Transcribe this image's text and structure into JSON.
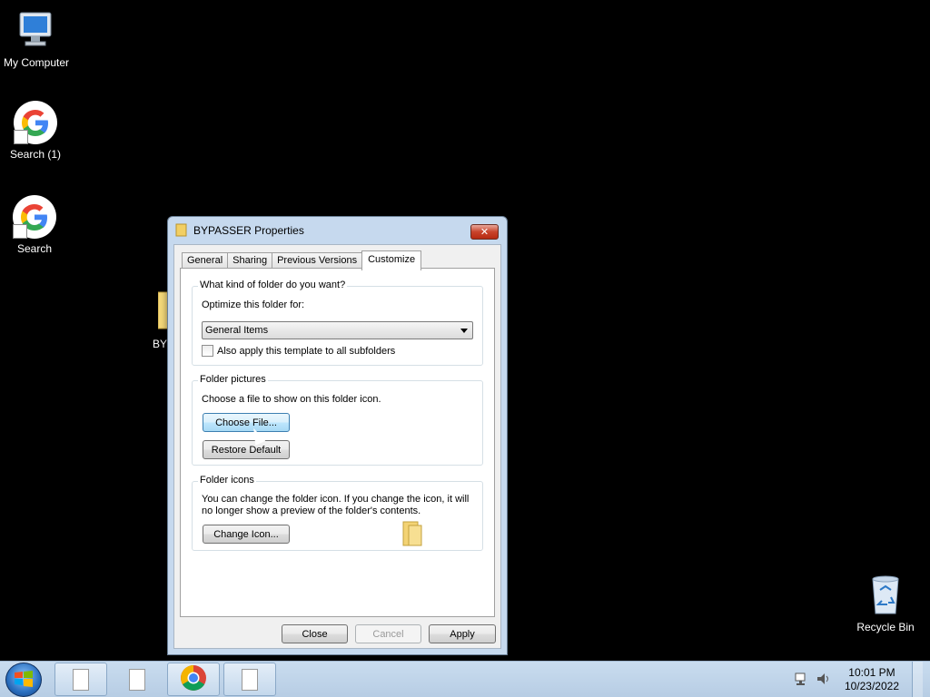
{
  "desktop": {
    "icons": [
      {
        "label": "My Computer",
        "icon": "computer-icon"
      },
      {
        "label": "Search (1)",
        "icon": "google-icon"
      },
      {
        "label": "Search",
        "icon": "google-icon"
      },
      {
        "label": "BY",
        "icon": "folder-icon"
      },
      {
        "label": "Recycle Bin",
        "icon": "recycle-bin-icon"
      }
    ]
  },
  "dialog": {
    "title": "BYPASSER Properties",
    "tabs": [
      "General",
      "Sharing",
      "Previous Versions",
      "Customize"
    ],
    "active_tab": "Customize",
    "kind_group": {
      "label": "What kind of folder do you want?",
      "optimize_label": "Optimize this folder for:",
      "optimize_value": "General Items",
      "apply_subfolders_label": "Also apply this template to all subfolders",
      "apply_subfolders_checked": false
    },
    "pictures_group": {
      "label": "Folder pictures",
      "description": "Choose a file to show on this folder icon.",
      "choose_file_label": "Choose File...",
      "restore_default_label": "Restore Default"
    },
    "icons_group": {
      "label": "Folder icons",
      "description_line1": "You can change the folder icon. If you change the icon, it will",
      "description_line2": "no longer show a preview of the folder's contents.",
      "change_icon_label": "Change Icon..."
    },
    "buttons": {
      "close": "Close",
      "cancel": "Cancel",
      "apply": "Apply"
    }
  },
  "taskbar": {
    "time": "10:01 PM",
    "date": "10/23/2022"
  },
  "colors": {
    "desktop_background": "#000000",
    "window_frame": "#c6d9ee",
    "close_button": "#c8432b",
    "taskbar": "#c9dcef"
  }
}
